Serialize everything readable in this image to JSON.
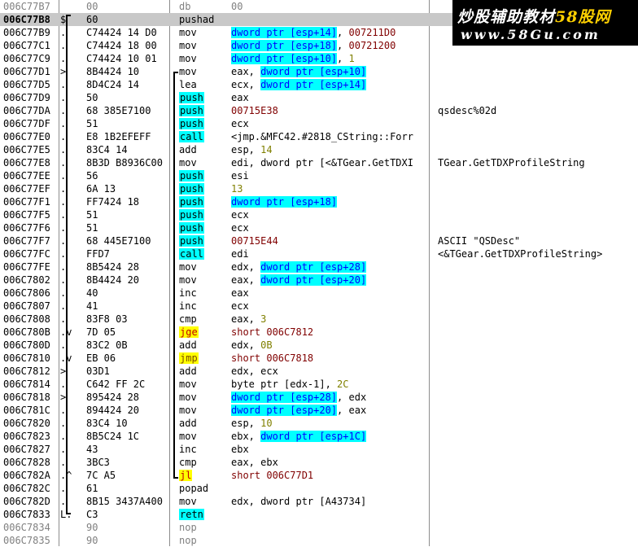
{
  "watermark": {
    "line1_main": "炒股辅助教材",
    "line1_accent": "58股网",
    "line2": "www.58Gu.com"
  },
  "rows": [
    {
      "addr": "006C77B7",
      "mark": "",
      "hex": "00",
      "mnem": "db",
      "ops": [
        [
          "00",
          "gray-t"
        ]
      ],
      "comment": "",
      "style": "gray"
    },
    {
      "addr": "006C77B8",
      "mark": "$",
      "hex": "60",
      "mnem": "pushad",
      "ops": [],
      "comment": "",
      "style": "selected"
    },
    {
      "addr": "006C77B9",
      "mark": ".",
      "hex": "C74424 14 D0",
      "mnem": "mov",
      "ops": [
        [
          "dword ptr [esp+14]",
          "hl"
        ],
        [
          ", ",
          "plain"
        ],
        [
          "007211D0",
          "adr"
        ]
      ],
      "comment": ""
    },
    {
      "addr": "006C77C1",
      "mark": ".",
      "hex": "C74424 18 00",
      "mnem": "mov",
      "ops": [
        [
          "dword ptr [esp+18]",
          "hl"
        ],
        [
          ", ",
          "plain"
        ],
        [
          "00721200",
          "adr"
        ]
      ],
      "comment": ""
    },
    {
      "addr": "006C77C9",
      "mark": ".",
      "hex": "C74424 10 01",
      "mnem": "mov",
      "ops": [
        [
          "dword ptr [esp+10]",
          "hl"
        ],
        [
          ", ",
          "plain"
        ],
        [
          "1",
          "imm"
        ]
      ],
      "comment": ""
    },
    {
      "addr": "006C77D1",
      "mark": ">",
      "hex": "8B4424 10",
      "mnem": "mov",
      "ops": [
        [
          "eax, ",
          "plain"
        ],
        [
          "dword ptr [esp+10]",
          "hl"
        ]
      ],
      "comment": ""
    },
    {
      "addr": "006C77D5",
      "mark": ".",
      "hex": "8D4C24 14",
      "mnem": "lea",
      "ops": [
        [
          "ecx, ",
          "plain"
        ],
        [
          "dword ptr [esp+14]",
          "hl"
        ]
      ],
      "comment": ""
    },
    {
      "addr": "006C77D9",
      "mark": ".",
      "hex": "50",
      "mnem": "push",
      "mclass": "m-push",
      "ops": [
        [
          "eax",
          "plain"
        ]
      ],
      "comment": ""
    },
    {
      "addr": "006C77DA",
      "mark": ".",
      "hex": "68 385E7100",
      "mnem": "push",
      "mclass": "m-push",
      "ops": [
        [
          "00715E38",
          "adr"
        ]
      ],
      "comment": "qsdesc%02d"
    },
    {
      "addr": "006C77DF",
      "mark": ".",
      "hex": "51",
      "mnem": "push",
      "mclass": "m-push",
      "ops": [
        [
          "ecx",
          "plain"
        ]
      ],
      "comment": ""
    },
    {
      "addr": "006C77E0",
      "mark": ".",
      "hex": "E8 1B2EFEFF",
      "mnem": "call",
      "mclass": "m-call",
      "ops": [
        [
          "<jmp.&MFC42.#2818_CString::Forr",
          "sym"
        ]
      ],
      "comment": ""
    },
    {
      "addr": "006C77E5",
      "mark": ".",
      "hex": "83C4 14",
      "mnem": "add",
      "ops": [
        [
          "esp, ",
          "plain"
        ],
        [
          "14",
          "imm"
        ]
      ],
      "comment": ""
    },
    {
      "addr": "006C77E8",
      "mark": ".",
      "hex": "8B3D B8936C00",
      "mnem": "mov",
      "ops": [
        [
          "edi, dword ptr [<&TGear.GetTDXI",
          "plain"
        ]
      ],
      "comment": "TGear.GetTDXProfileString"
    },
    {
      "addr": "006C77EE",
      "mark": ".",
      "hex": "56",
      "mnem": "push",
      "mclass": "m-push",
      "ops": [
        [
          "esi",
          "plain"
        ]
      ],
      "comment": ""
    },
    {
      "addr": "006C77EF",
      "mark": ".",
      "hex": "6A 13",
      "mnem": "push",
      "mclass": "m-push",
      "ops": [
        [
          "13",
          "imm"
        ]
      ],
      "comment": ""
    },
    {
      "addr": "006C77F1",
      "mark": ".",
      "hex": "FF7424 18",
      "mnem": "push",
      "mclass": "m-push",
      "ops": [
        [
          "dword ptr [esp+18]",
          "hl"
        ]
      ],
      "comment": ""
    },
    {
      "addr": "006C77F5",
      "mark": ".",
      "hex": "51",
      "mnem": "push",
      "mclass": "m-push",
      "ops": [
        [
          "ecx",
          "plain"
        ]
      ],
      "comment": ""
    },
    {
      "addr": "006C77F6",
      "mark": ".",
      "hex": "51",
      "mnem": "push",
      "mclass": "m-push",
      "ops": [
        [
          "ecx",
          "plain"
        ]
      ],
      "comment": ""
    },
    {
      "addr": "006C77F7",
      "mark": ".",
      "hex": "68 445E7100",
      "mnem": "push",
      "mclass": "m-push",
      "ops": [
        [
          "00715E44",
          "adr"
        ]
      ],
      "comment": "ASCII \"QSDesc\""
    },
    {
      "addr": "006C77FC",
      "mark": ".",
      "hex": "FFD7",
      "mnem": "call",
      "mclass": "m-call",
      "ops": [
        [
          "edi",
          "plain"
        ]
      ],
      "comment": "<&TGear.GetTDXProfileString>"
    },
    {
      "addr": "006C77FE",
      "mark": ".",
      "hex": "8B5424 28",
      "mnem": "mov",
      "ops": [
        [
          "edx, ",
          "plain"
        ],
        [
          "dword ptr [esp+28]",
          "hl"
        ]
      ],
      "comment": ""
    },
    {
      "addr": "006C7802",
      "mark": ".",
      "hex": "8B4424 20",
      "mnem": "mov",
      "ops": [
        [
          "eax, ",
          "plain"
        ],
        [
          "dword ptr [esp+20]",
          "hl"
        ]
      ],
      "comment": ""
    },
    {
      "addr": "006C7806",
      "mark": ".",
      "hex": "40",
      "mnem": "inc",
      "ops": [
        [
          "eax",
          "plain"
        ]
      ],
      "comment": ""
    },
    {
      "addr": "006C7807",
      "mark": ".",
      "hex": "41",
      "mnem": "inc",
      "ops": [
        [
          "ecx",
          "plain"
        ]
      ],
      "comment": ""
    },
    {
      "addr": "006C7808",
      "mark": ".",
      "hex": "83F8 03",
      "mnem": "cmp",
      "ops": [
        [
          "eax, ",
          "plain"
        ],
        [
          "3",
          "imm"
        ]
      ],
      "comment": ""
    },
    {
      "addr": "006C780B",
      "mark": ".v",
      "hex": "7D 05",
      "mnem": "jge",
      "mclass": "m-jcc",
      "ops": [
        [
          "short 006C7812",
          "jt"
        ]
      ],
      "comment": ""
    },
    {
      "addr": "006C780D",
      "mark": ".",
      "hex": "83C2 0B",
      "mnem": "add",
      "ops": [
        [
          "edx, ",
          "plain"
        ],
        [
          "0B",
          "imm"
        ]
      ],
      "comment": ""
    },
    {
      "addr": "006C7810",
      "mark": ".v",
      "hex": "EB 06",
      "mnem": "jmp",
      "mclass": "m-jmp",
      "ops": [
        [
          "short 006C7818",
          "jt"
        ]
      ],
      "comment": ""
    },
    {
      "addr": "006C7812",
      "mark": ">",
      "hex": "03D1",
      "mnem": "add",
      "ops": [
        [
          "edx, ecx",
          "plain"
        ]
      ],
      "comment": ""
    },
    {
      "addr": "006C7814",
      "mark": ".",
      "hex": "C642 FF 2C",
      "mnem": "mov",
      "ops": [
        [
          "byte ptr [edx-1], ",
          "plain"
        ],
        [
          "2C",
          "imm"
        ]
      ],
      "comment": ""
    },
    {
      "addr": "006C7818",
      "mark": ">",
      "hex": "895424 28",
      "mnem": "mov",
      "ops": [
        [
          "dword ptr [esp+28]",
          "hl"
        ],
        [
          ", edx",
          "plain"
        ]
      ],
      "comment": ""
    },
    {
      "addr": "006C781C",
      "mark": ".",
      "hex": "894424 20",
      "mnem": "mov",
      "ops": [
        [
          "dword ptr [esp+20]",
          "hl"
        ],
        [
          ", eax",
          "plain"
        ]
      ],
      "comment": ""
    },
    {
      "addr": "006C7820",
      "mark": ".",
      "hex": "83C4 10",
      "mnem": "add",
      "ops": [
        [
          "esp, ",
          "plain"
        ],
        [
          "10",
          "imm"
        ]
      ],
      "comment": ""
    },
    {
      "addr": "006C7823",
      "mark": ".",
      "hex": "8B5C24 1C",
      "mnem": "mov",
      "ops": [
        [
          "ebx, ",
          "plain"
        ],
        [
          "dword ptr [esp+1C]",
          "hl"
        ]
      ],
      "comment": ""
    },
    {
      "addr": "006C7827",
      "mark": ".",
      "hex": "43",
      "mnem": "inc",
      "ops": [
        [
          "ebx",
          "plain"
        ]
      ],
      "comment": ""
    },
    {
      "addr": "006C7828",
      "mark": ".",
      "hex": "3BC3",
      "mnem": "cmp",
      "ops": [
        [
          "eax, ebx",
          "plain"
        ]
      ],
      "comment": ""
    },
    {
      "addr": "006C782A",
      "mark": ".^",
      "hex": "7C A5",
      "mnem": "jl",
      "mclass": "m-jcc",
      "ops": [
        [
          "short 006C77D1",
          "jt"
        ]
      ],
      "comment": ""
    },
    {
      "addr": "006C782C",
      "mark": ".",
      "hex": "61",
      "mnem": "popad",
      "ops": [],
      "comment": ""
    },
    {
      "addr": "006C782D",
      "mark": ".",
      "hex": "8B15 3437A400",
      "mnem": "mov",
      "ops": [
        [
          "edx, dword ptr [A43734]",
          "plain"
        ]
      ],
      "comment": ""
    },
    {
      "addr": "006C7833",
      "mark": "L.",
      "hex": "C3",
      "mnem": "retn",
      "mclass": "m-ret",
      "ops": [],
      "comment": ""
    },
    {
      "addr": "006C7834",
      "mark": "",
      "hex": "90",
      "mnem": "nop",
      "ops": [],
      "comment": "",
      "style": "gray"
    },
    {
      "addr": "006C7835",
      "mark": "",
      "hex": "90",
      "mnem": "nop",
      "ops": [],
      "comment": "",
      "style": "gray"
    }
  ]
}
